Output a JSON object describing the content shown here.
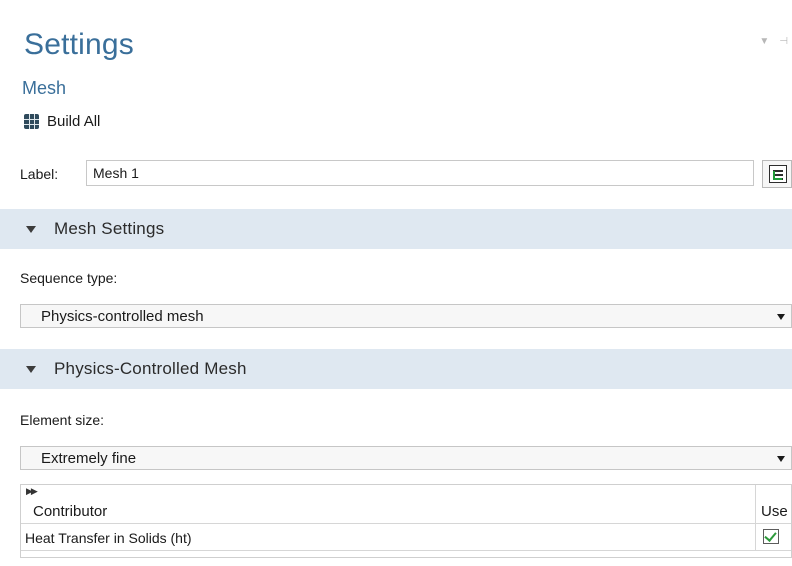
{
  "panel": {
    "title": "Settings",
    "subtitle": "Mesh"
  },
  "toolbar": {
    "build_all_label": "Build All",
    "build_all_icon": "mesh-grid-icon"
  },
  "label_field": {
    "label": "Label:",
    "value": "Mesh 1",
    "edit_icon": "edit-label-icon"
  },
  "mesh_settings": {
    "header": "Mesh Settings",
    "sequence_type_label": "Sequence type:",
    "sequence_type_value": "Physics-controlled mesh"
  },
  "physics_controlled_mesh": {
    "header": "Physics-Controlled Mesh",
    "element_size_label": "Element size:",
    "element_size_value": "Extremely fine",
    "table": {
      "columns": [
        "Contributor",
        "Use"
      ],
      "rows": [
        {
          "contributor": "Heat Transfer in Solids (ht)",
          "use": true
        }
      ]
    }
  },
  "colors": {
    "title": "#3a6f9a",
    "section_header_bg": "#dfe8f1",
    "check_green": "#2d9a3b"
  }
}
